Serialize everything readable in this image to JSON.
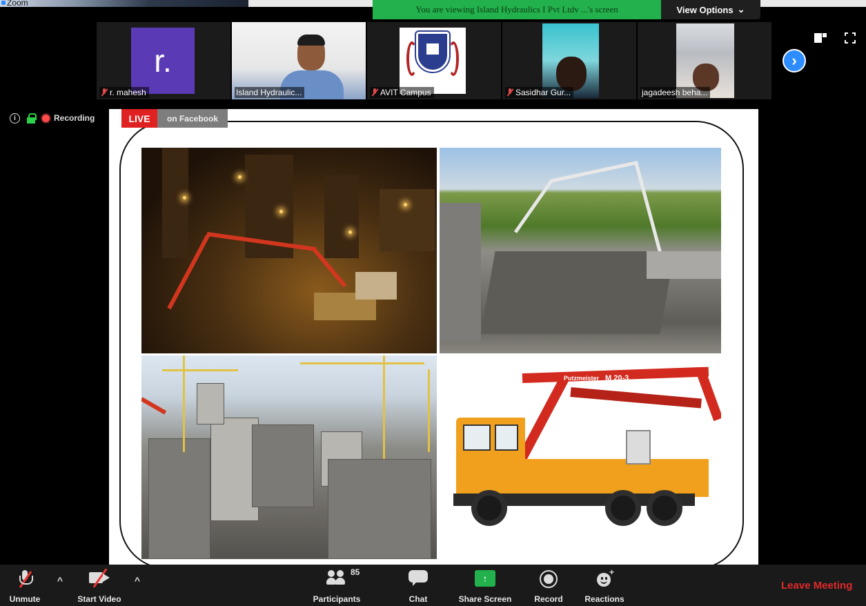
{
  "window": {
    "app_title": "Zoom"
  },
  "share_banner": {
    "text": "You are viewing Island Hydraulics I Pvt Ltdv  ...'s screen"
  },
  "view_options": {
    "label": "View Options",
    "caret": "⌄"
  },
  "gallery": {
    "tiles": [
      {
        "name": "r. mahesh",
        "muted": true,
        "avatar_letter": "r.",
        "avatar_color": "#5b3bb5"
      },
      {
        "name": "Island Hydraulic...",
        "muted": false,
        "active_speaker": true
      },
      {
        "name": "AVIT Campus",
        "muted": true
      },
      {
        "name": "Sasidhar Gur...",
        "muted": true
      },
      {
        "name": "jagadeesh beha...",
        "muted": false
      }
    ],
    "next_icon": "›"
  },
  "status": {
    "info_glyph": "i",
    "recording_label": "Recording",
    "live_label": "LIVE",
    "live_platform": "on Facebook"
  },
  "slide": {
    "photos": [
      {
        "icon": "night-construction-pump-image"
      },
      {
        "icon": "bridge-deck-pump-image"
      },
      {
        "icon": "high-rise-construction-site-image"
      },
      {
        "icon": "concrete-pump-truck-image"
      }
    ],
    "truck_boom_text": "Putzmeister",
    "truck_model_text": "M 20-3"
  },
  "toolbar": {
    "unmute": "Unmute",
    "start_video": "Start Video",
    "participants": "Participants",
    "participants_count": "85",
    "chat": "Chat",
    "share_screen": "Share Screen",
    "share_glyph": "↑",
    "record": "Record",
    "reactions": "Reactions",
    "reactions_plus": "+",
    "leave": "Leave Meeting",
    "caret": "^"
  },
  "colors": {
    "accent": "#2d8cff",
    "share_green": "#22b14c",
    "live_red": "#e02121",
    "leave_red": "#e02a2a"
  }
}
